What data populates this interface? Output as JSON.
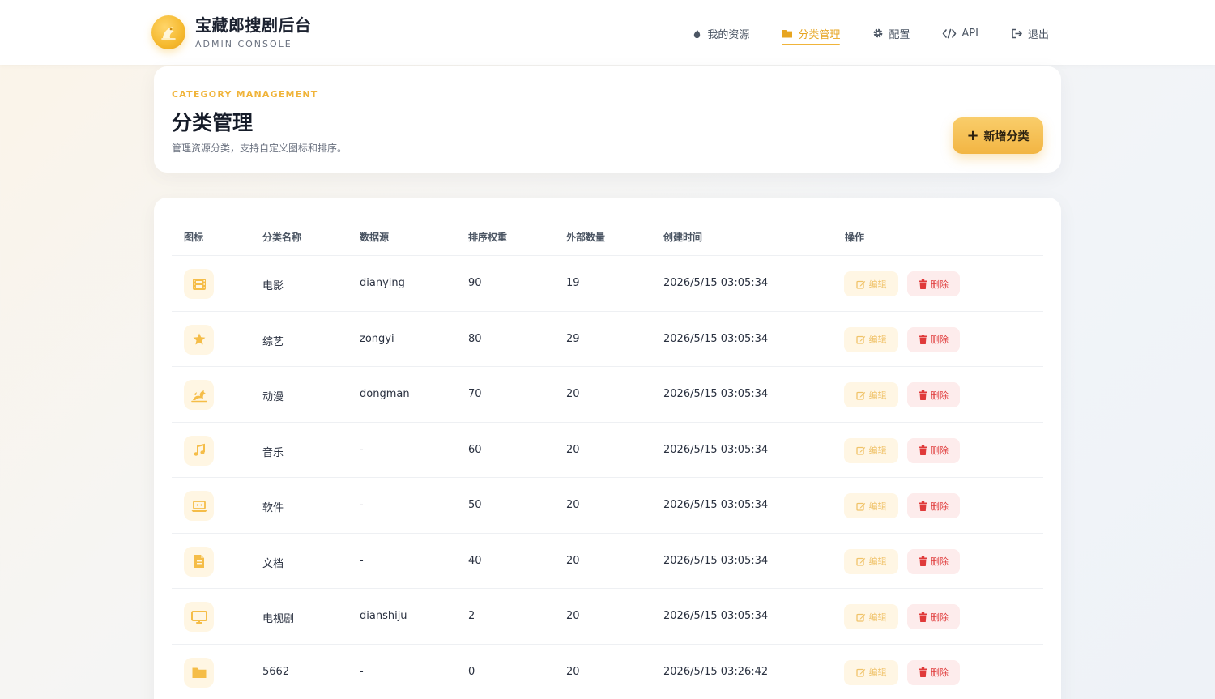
{
  "brand": {
    "title": "宝藏郎搜剧后台",
    "subtitle": "ADMIN CONSOLE"
  },
  "nav": [
    {
      "label": "我的资源",
      "icon": "fire-icon",
      "active": false
    },
    {
      "label": "分类管理",
      "icon": "folder-icon",
      "active": true
    },
    {
      "label": "配置",
      "icon": "gear-icon",
      "active": false
    },
    {
      "label": "API",
      "icon": "code-icon",
      "active": false
    },
    {
      "label": "退出",
      "icon": "logout-icon",
      "active": false
    }
  ],
  "header": {
    "eyebrow": "CATEGORY MANAGEMENT",
    "title": "分类管理",
    "description": "管理资源分类，支持自定义图标和排序。",
    "add_label": "新增分类"
  },
  "table": {
    "columns": [
      "图标",
      "分类名称",
      "数据源",
      "排序权重",
      "外部数量",
      "创建时间",
      "操作"
    ],
    "edit_label": "编辑",
    "delete_label": "删除",
    "rows": [
      {
        "icon": "film-icon",
        "name": "电影",
        "source": "dianying",
        "weight": "90",
        "count": "19",
        "created": "2026/5/15 03:05:34"
      },
      {
        "icon": "star-icon",
        "name": "综艺",
        "source": "zongyi",
        "weight": "80",
        "count": "29",
        "created": "2026/5/15 03:05:34"
      },
      {
        "icon": "dragon-icon",
        "name": "动漫",
        "source": "dongman",
        "weight": "70",
        "count": "20",
        "created": "2026/5/15 03:05:34"
      },
      {
        "icon": "music-icon",
        "name": "音乐",
        "source": "-",
        "weight": "60",
        "count": "20",
        "created": "2026/5/15 03:05:34"
      },
      {
        "icon": "laptop-icon",
        "name": "软件",
        "source": "-",
        "weight": "50",
        "count": "20",
        "created": "2026/5/15 03:05:34"
      },
      {
        "icon": "document-icon",
        "name": "文档",
        "source": "-",
        "weight": "40",
        "count": "20",
        "created": "2026/5/15 03:05:34"
      },
      {
        "icon": "tv-icon",
        "name": "电视剧",
        "source": "dianshiju",
        "weight": "2",
        "count": "20",
        "created": "2026/5/15 03:05:34"
      },
      {
        "icon": "folder-icon",
        "name": "5662",
        "source": "-",
        "weight": "0",
        "count": "20",
        "created": "2026/5/15 03:26:42"
      }
    ]
  },
  "colors": {
    "accent": "#f0b43a",
    "danger": "#e03a3a",
    "icon_bg": "#fff6e3"
  }
}
